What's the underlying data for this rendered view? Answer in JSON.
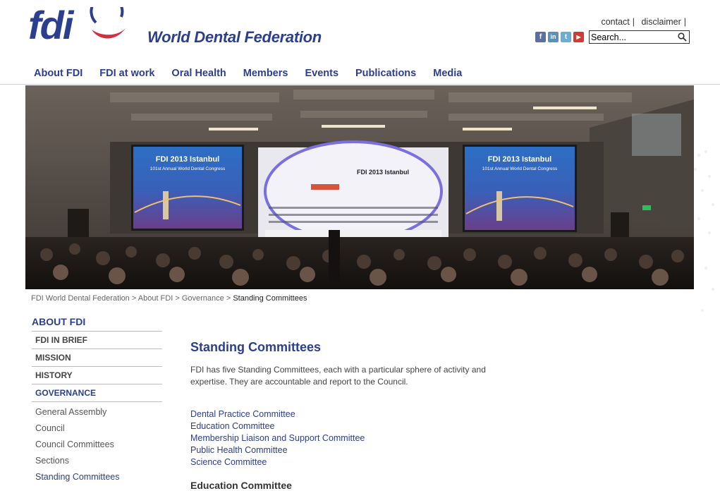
{
  "header": {
    "logo_text": "fdi",
    "org_name": "World Dental Federation",
    "top_links": [
      "contact",
      "disclaimer"
    ],
    "social": [
      {
        "name": "facebook-icon",
        "glyph": "f",
        "color": "#5a6fa6"
      },
      {
        "name": "linkedin-icon",
        "glyph": "in",
        "color": "#5a8fbe"
      },
      {
        "name": "twitter-icon",
        "glyph": "t",
        "color": "#6aaed8"
      },
      {
        "name": "youtube-icon",
        "glyph": "▶",
        "color": "#d23a33"
      }
    ],
    "search_placeholder": "Search..."
  },
  "nav": [
    "About FDI",
    "FDI at work",
    "Oral Health",
    "Members",
    "Events",
    "Publications",
    "Media"
  ],
  "hero": {
    "screen_title": "FDI 2013 Istanbul",
    "screen_subtitle": "101st Annual World Dental Congress",
    "stage_title": "FDI 2013 Istanbul"
  },
  "breadcrumb": {
    "items": [
      "FDI World Dental Federation",
      "About FDI",
      "Governance"
    ],
    "current": "Standing Committees"
  },
  "sidebar": {
    "title": "ABOUT FDI",
    "items": [
      "FDI IN BRIEF",
      "MISSION",
      "HISTORY",
      "GOVERNANCE"
    ],
    "active_index": 3,
    "subitems": [
      "General Assembly",
      "Council",
      "Council Committees",
      "Sections",
      "Standing Committees"
    ],
    "active_sub_index": 4
  },
  "content": {
    "title": "Standing Committees",
    "intro": "FDI has five Standing Committees, each with a particular sphere of activity and expertise. They are accountable and report to the Council.",
    "committees": [
      "Dental Practice Committee",
      "Education Committee",
      "Membership Liaison and Support Committee",
      "Public Health Committee",
      "Science Committee"
    ],
    "section_heading": "Education Committee"
  },
  "colors": {
    "brand_blue": "#2b3f8e",
    "brand_red": "#d32f3f"
  }
}
